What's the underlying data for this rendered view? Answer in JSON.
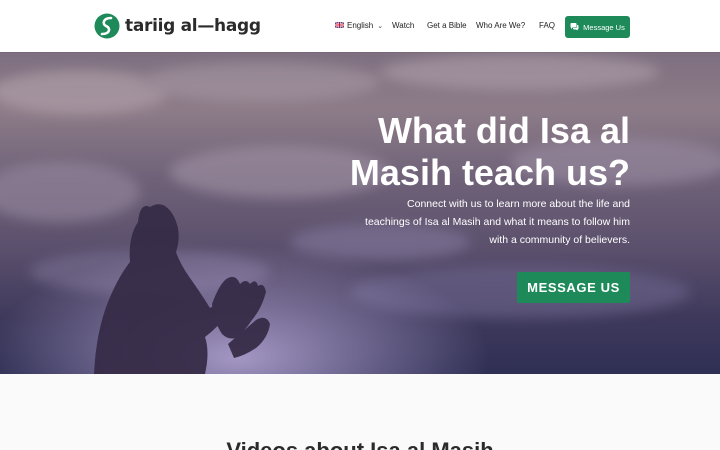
{
  "brand": {
    "logo_text": "tariig al—hagg",
    "accent": "#1e8a5a"
  },
  "nav": {
    "language": "English",
    "items": [
      "Watch",
      "Get a Bible",
      "Who Are We?",
      "FAQ"
    ],
    "message_button": "Message Us"
  },
  "hero": {
    "title": "What did Isa al Masih teach us?",
    "subtitle": "Connect with us to learn more about the life and teachings of Isa al Masih and what it means to follow him with a community of believers.",
    "cta": "MESSAGE US"
  },
  "section2": {
    "title": "Videos about Isa al Masih"
  }
}
